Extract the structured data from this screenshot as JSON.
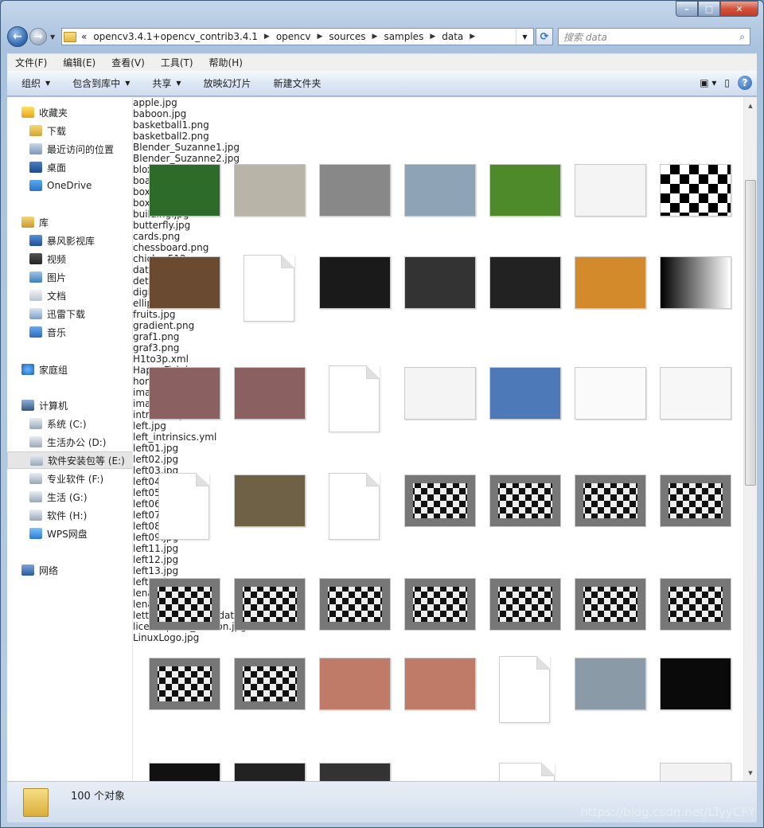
{
  "window": {
    "minimize": "–",
    "maximize": "□",
    "close": "✕"
  },
  "address": {
    "overflow": "«",
    "crumbs": [
      "opencv3.4.1+opencv_contrib3.4.1",
      "opencv",
      "sources",
      "samples",
      "data"
    ],
    "search_placeholder": "搜索 data"
  },
  "menu": [
    "文件(F)",
    "编辑(E)",
    "查看(V)",
    "工具(T)",
    "帮助(H)"
  ],
  "toolbar": [
    "组织",
    "包含到库中",
    "共享",
    "放映幻灯片",
    "新建文件夹"
  ],
  "nav": {
    "favorites": "收藏夹",
    "fav_items": [
      "下载",
      "最近访问的位置",
      "桌面",
      "OneDrive"
    ],
    "library": "库",
    "lib_items": [
      "暴风影视库",
      "视频",
      "图片",
      "文档",
      "迅雷下载",
      "音乐"
    ],
    "homegroup": "家庭组",
    "computer": "计算机",
    "drives": [
      "系统 (C:)",
      "生活办公 (D:)",
      "软件安装包等 (E:)",
      "专业软件 (F:)",
      "生活 (G:)",
      "软件 (H:)",
      "WPS网盘"
    ],
    "network": "网络"
  },
  "files": [
    [
      "apple.jpg",
      "baboon.jpg",
      "basketball1.png",
      "basketball2.png",
      "Blender_Suzanne1.jpg",
      "Blender_Suzanne2.jpg",
      "blox.jpg"
    ],
    [
      "board.jpg",
      "box.png",
      "box_in_scene.png",
      "building.jpg",
      "butterfly.jpg",
      "cards.png",
      "chessboard.png"
    ],
    [
      "chicky_512.png",
      "data01.xml",
      "detect_blob.png",
      "digits.png",
      "ellipses.jpg",
      "fruits.jpg",
      "gradient.png"
    ],
    [
      "graf1.png",
      "graf3.png",
      "H1to3p.xml",
      "HappyFish.jpg",
      "home.jpg",
      "imageTextN.png",
      "imageTextR.png"
    ],
    [
      "intrinsics.yml",
      "left.jpg",
      "left_intrinsics.yml",
      "left01.jpg",
      "left02.jpg",
      "left03.jpg",
      "left04.jpg"
    ],
    [
      "left05.jpg",
      "left06.jpg",
      "left07.jpg",
      "left08.jpg",
      "left09.jpg",
      "left11.jpg",
      "left12.jpg"
    ],
    [
      "left13.jpg",
      "left14.jpg",
      "lena.jpg",
      "lena_tmpl.jpg",
      "letter-recognition.data",
      "licenseplate_motion.jpg",
      "LinuxLogo.jpg"
    ]
  ],
  "status": {
    "count": "100 个对象"
  },
  "watermark": "https://blog.csdn.net/LTyyCFY",
  "colors": {
    "accent": "#3a6fb5",
    "selection": "#e5e5e5"
  }
}
